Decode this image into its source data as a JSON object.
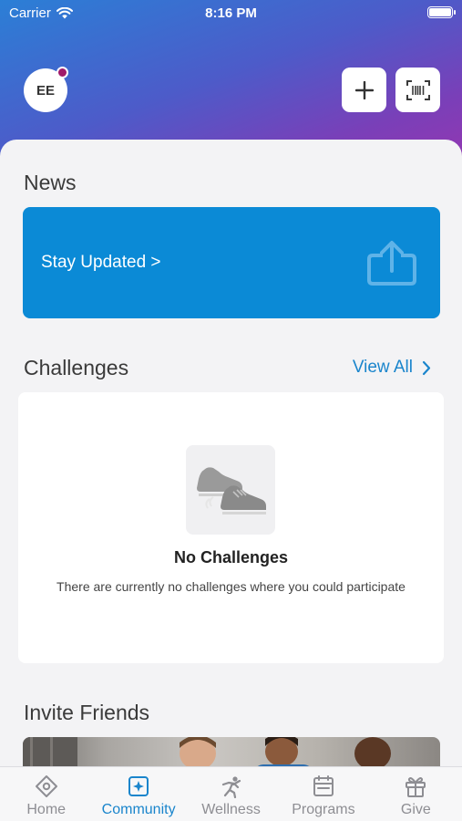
{
  "status_bar": {
    "carrier": "Carrier",
    "time": "8:16 PM"
  },
  "header": {
    "avatar_initials": "EE"
  },
  "news": {
    "title": "News",
    "card_label": "Stay Updated >"
  },
  "challenges": {
    "title": "Challenges",
    "view_all": "View All",
    "empty_title": "No Challenges",
    "empty_description": "There are currently no challenges where you could participate"
  },
  "invite": {
    "title": "Invite Friends"
  },
  "tabs": [
    {
      "label": "Home",
      "icon": "home-icon"
    },
    {
      "label": "Community",
      "icon": "community-icon",
      "active": true
    },
    {
      "label": "Wellness",
      "icon": "wellness-icon"
    },
    {
      "label": "Programs",
      "icon": "programs-icon"
    },
    {
      "label": "Give",
      "icon": "give-icon"
    }
  ],
  "colors": {
    "accent": "#1a85cc",
    "news_card": "#0b8ad6",
    "avatar_badge": "#a01a6a"
  }
}
